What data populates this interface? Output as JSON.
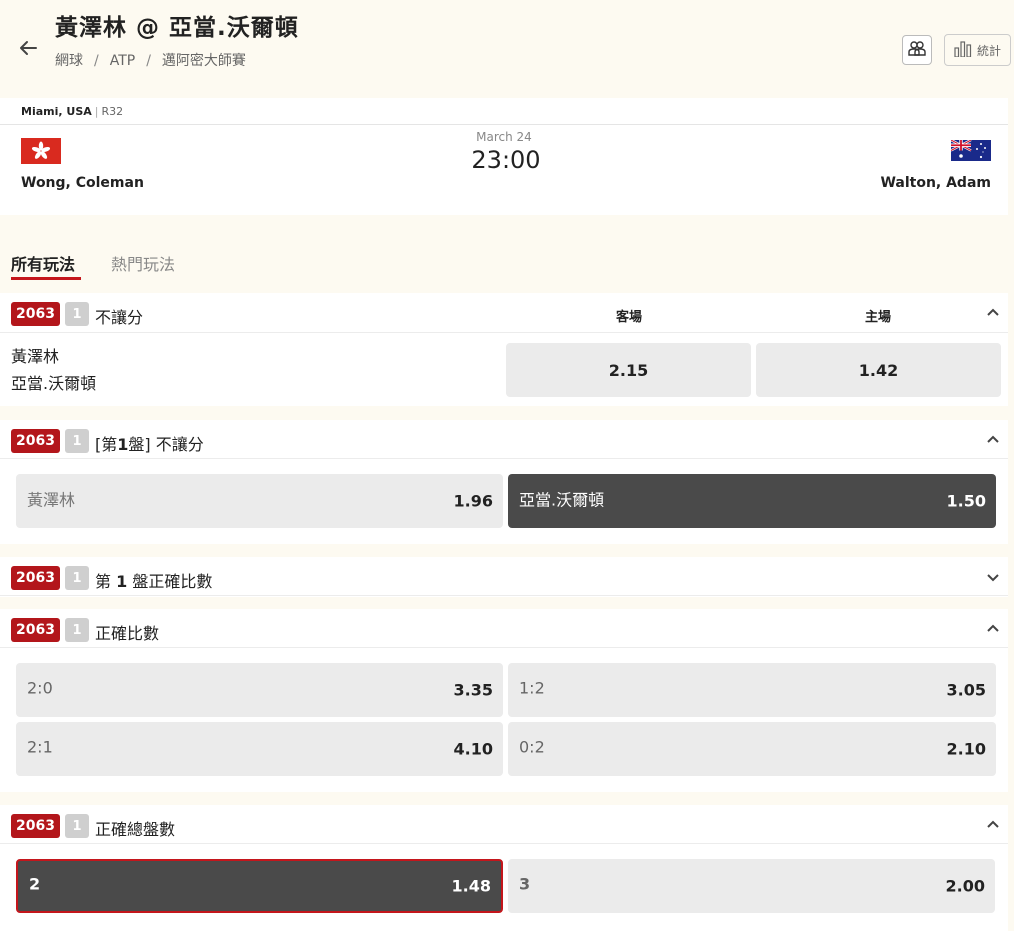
{
  "header": {
    "title": "黃澤林 @ 亞當.沃爾頓",
    "breadcrumb": [
      "網球",
      "ATP",
      "邁阿密大師賽"
    ],
    "stats_label": "統計"
  },
  "match": {
    "venue": "Miami, USA",
    "round": "R32",
    "date": "March 24",
    "time": "23:00",
    "home_player": "Wong, Coleman",
    "away_player": "Walton, Adam"
  },
  "tabs": [
    "所有玩法",
    "熱門玩法"
  ],
  "markets": {
    "m1": {
      "id": "2063",
      "count": "1",
      "title": "不讓分",
      "col_away": "客場",
      "col_home": "主場",
      "name1": "黃澤林",
      "name2": "亞當.沃爾頓",
      "odd_away": "2.15",
      "odd_home": "1.42"
    },
    "m2": {
      "id": "2063",
      "count": "1",
      "title_pre": "[第",
      "title_num": "1",
      "title_post": "盤] 不讓分",
      "a_label": "黃澤林",
      "a_odd": "1.96",
      "b_label": "亞當.沃爾頓",
      "b_odd": "1.50"
    },
    "m3": {
      "id": "2063",
      "count": "1",
      "title_pre": "第 ",
      "title_num": "1",
      "title_post": " 盤正確比數"
    },
    "m4": {
      "id": "2063",
      "count": "1",
      "title": "正確比數",
      "options": [
        {
          "label": "2:0",
          "odd": "3.35"
        },
        {
          "label": "1:2",
          "odd": "3.05"
        },
        {
          "label": "2:1",
          "odd": "4.10"
        },
        {
          "label": "0:2",
          "odd": "2.10"
        }
      ]
    },
    "m5": {
      "id": "2063",
      "count": "1",
      "title": "正確總盤數",
      "options": [
        {
          "label": "2",
          "odd": "1.48"
        },
        {
          "label": "3",
          "odd": "2.00"
        }
      ]
    }
  },
  "colors": {
    "brand_red": "#b3161b",
    "selected_dark": "#4a4a4a",
    "page_bg": "#fdfaf1"
  }
}
